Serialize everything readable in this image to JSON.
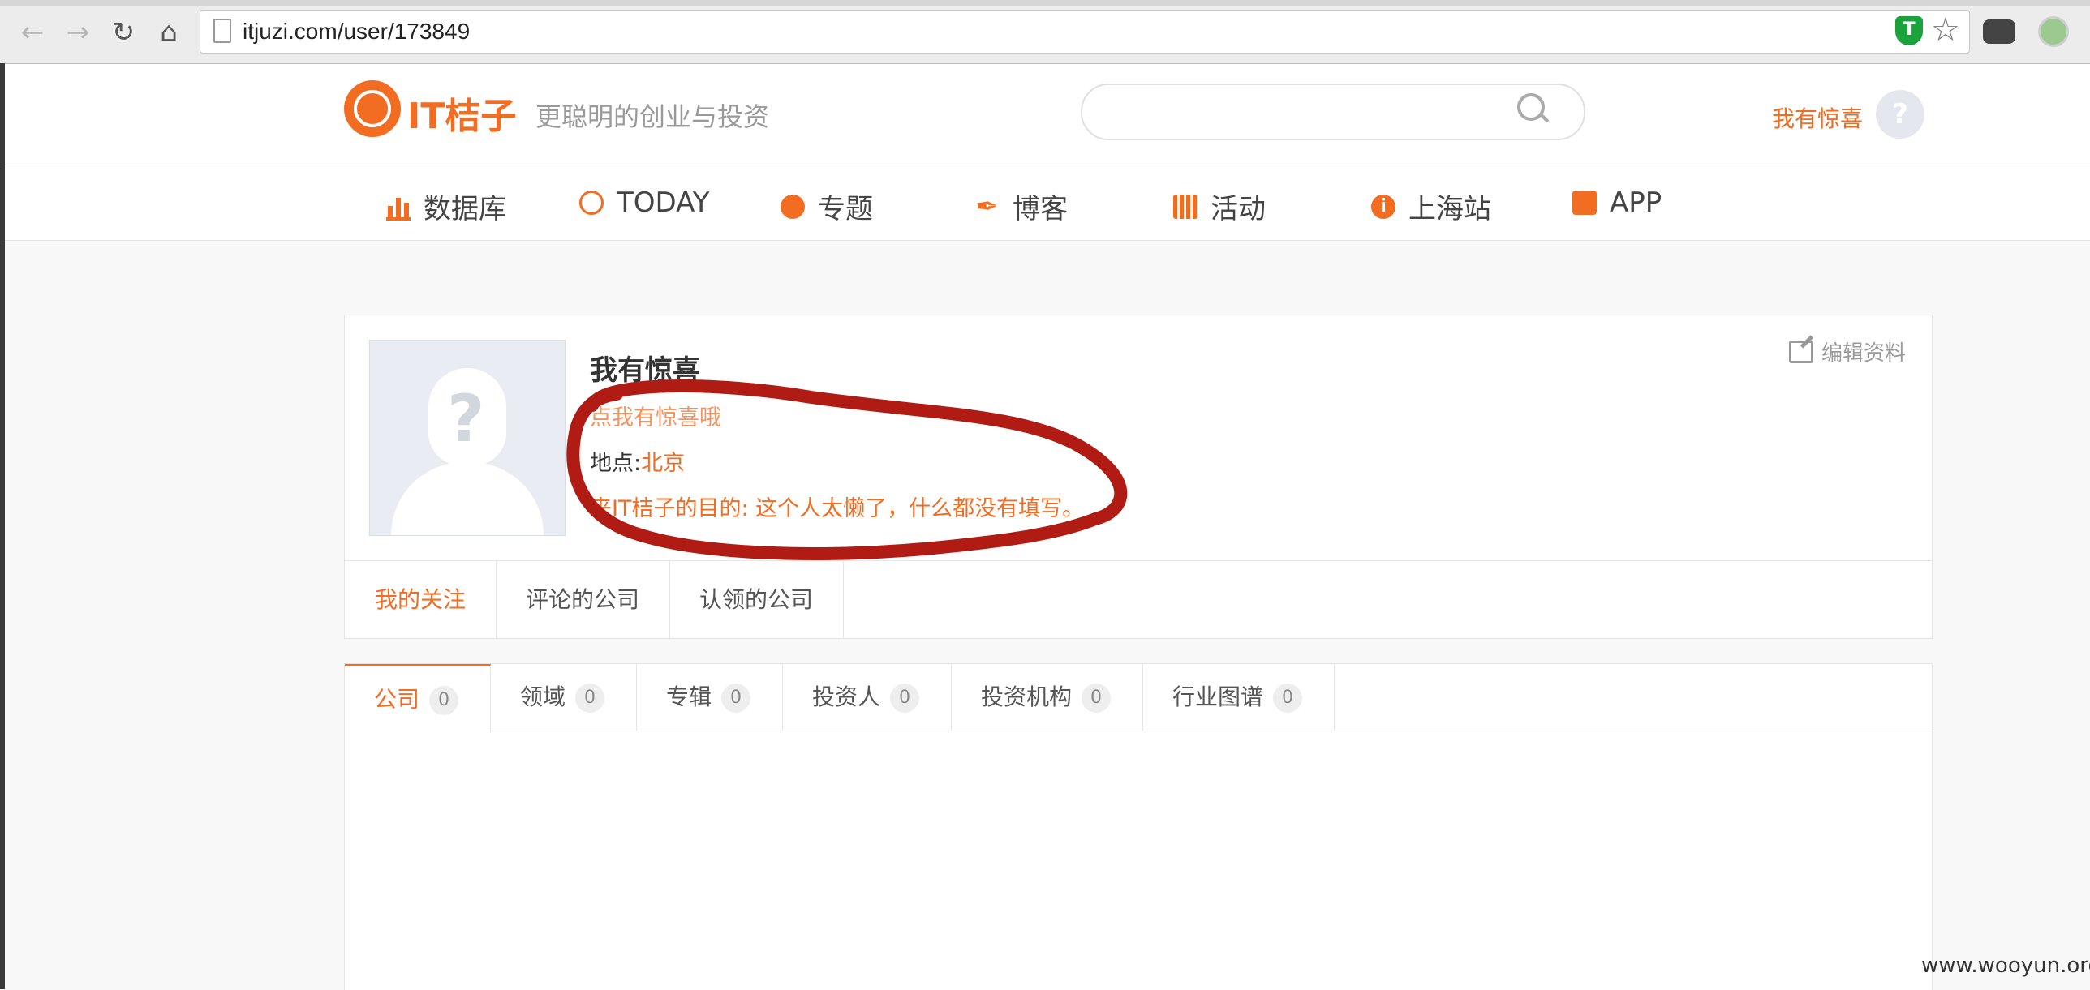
{
  "browser": {
    "url": "itjuzi.com/user/173849",
    "extension_shield_label": "T"
  },
  "header": {
    "logo_text": "IT桔子",
    "slogan": "更聪明的创业与投资",
    "username": "我有惊喜",
    "avatar_glyph": "?"
  },
  "nav": {
    "items": [
      {
        "label": "数据库",
        "icon": "bar-chart-icon"
      },
      {
        "label": "TODAY",
        "icon": "ring-icon"
      },
      {
        "label": "专题",
        "icon": "pie-icon"
      },
      {
        "label": "博客",
        "icon": "feather-icon"
      },
      {
        "label": "活动",
        "icon": "calendar-icon"
      },
      {
        "label": "上海站",
        "icon": "info-icon"
      },
      {
        "label": "APP",
        "icon": "app-icon"
      }
    ]
  },
  "profile": {
    "name": "我有惊喜",
    "tagline": "点我有惊喜哦",
    "location_label": "地点:",
    "location_value": "北京",
    "purpose": "来IT桔子的目的: 这个人太懒了，什么都没有填写。",
    "edit_label": "编辑资料",
    "tabs": [
      "我的关注",
      "评论的公司",
      "认领的公司"
    ]
  },
  "follow_tabs": [
    {
      "label": "公司",
      "count": "0"
    },
    {
      "label": "领域",
      "count": "0"
    },
    {
      "label": "专辑",
      "count": "0"
    },
    {
      "label": "投资人",
      "count": "0"
    },
    {
      "label": "投资机构",
      "count": "0"
    },
    {
      "label": "行业图谱",
      "count": "0"
    }
  ],
  "watermark": "www.wooyun.org",
  "colors": {
    "accent": "#f26c22",
    "annotation": "#b01c14"
  }
}
